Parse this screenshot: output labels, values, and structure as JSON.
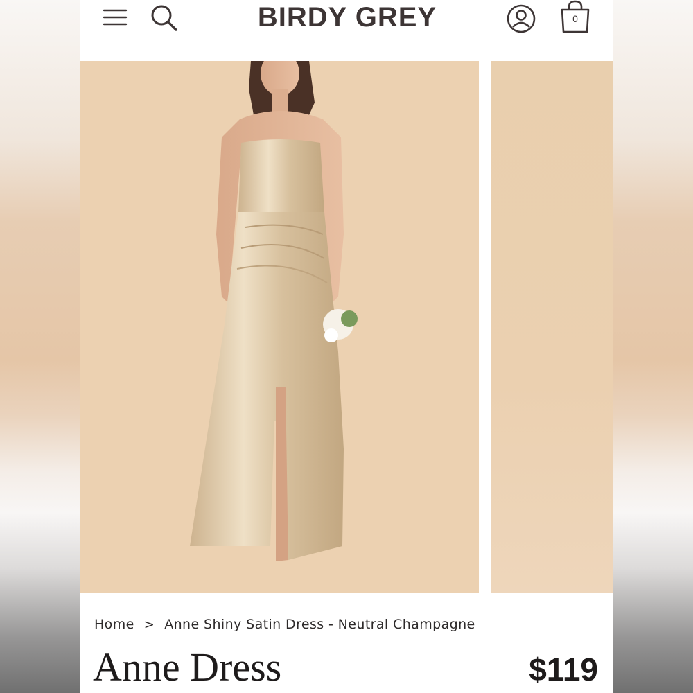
{
  "header": {
    "menu_icon": "hamburger-menu-icon",
    "search_icon": "search-icon",
    "logo_text": "BIRDY GREY",
    "account_icon": "account-icon",
    "cart_icon": "shopping-bag-icon",
    "cart_count": "0"
  },
  "gallery": {
    "background_color": "#ecd1b1",
    "dress_color": "#dcc6a3"
  },
  "breadcrumb": {
    "home": "Home",
    "separator": ">",
    "current": "Anne Shiny Satin Dress - Neutral Champagne"
  },
  "product": {
    "title": "Anne Dress",
    "price": "$119"
  },
  "colors": {
    "text": "#1e1b1b",
    "logo": "#3d3535"
  }
}
